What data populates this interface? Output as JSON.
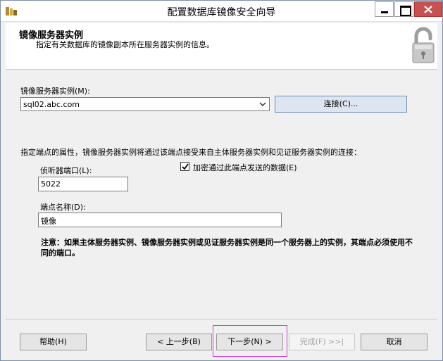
{
  "window": {
    "title": "配置数据库镜像安全向导"
  },
  "header": {
    "title": "镜像服务器实例",
    "subtitle": "指定有关数据库的镜像副本所在服务器实例的信息。",
    "icon": "lock-icon"
  },
  "mirror_instance": {
    "label": "镜像服务器实例(M):",
    "value": "sql02.abc.com",
    "connect_label": "连接(C)..."
  },
  "endpoint": {
    "description": "指定端点的属性，镜像服务器实例将通过该端点接受来自主体服务器实例和见证服务器实例的连接：",
    "port_label": "侦听器端口(L):",
    "port_value": "5022",
    "encrypt_label": "加密通过此端点发送的数据(E)",
    "encrypt_checked": true,
    "name_label": "端点名称(D):",
    "name_value": "镜像"
  },
  "note": "注意：如果主体服务器实例、镜像服务器实例或见证服务器实例是同一个服务器上的实例，其端点必须使用不同的端口。",
  "footer": {
    "help": "帮助(H)",
    "back": "< 上一步(B)",
    "next": "下一步(N) >",
    "finish": "完成(F) >>|",
    "cancel": "取消"
  }
}
